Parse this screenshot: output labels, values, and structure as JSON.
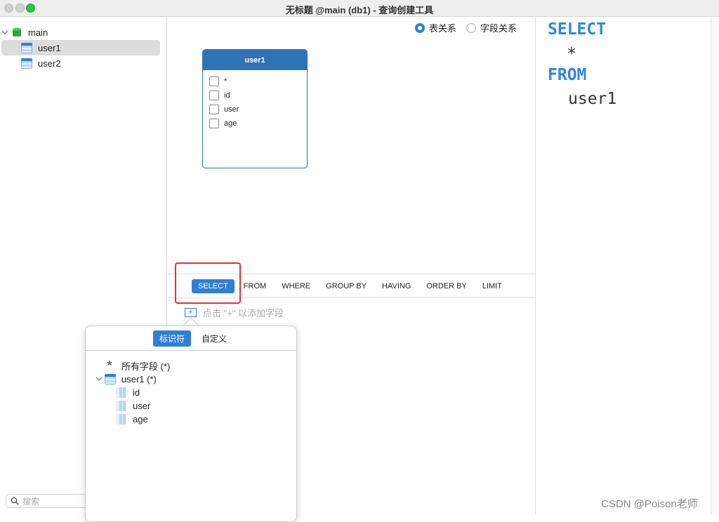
{
  "window": {
    "title": "无标题 @main (db1) - 查询创建工具"
  },
  "sidebar": {
    "database": "main",
    "tables": [
      "user1",
      "user2"
    ],
    "search_placeholder": "搜索"
  },
  "canvas": {
    "radio_table_relation": "表关系",
    "radio_field_relation": "字段关系",
    "table_card": {
      "name": "user1",
      "fields": [
        "*",
        "id",
        "user",
        "age"
      ]
    }
  },
  "clauses": [
    "SELECT",
    "FROM",
    "WHERE",
    "GROUP BY",
    "HAVING",
    "ORDER BY",
    "LIMIT"
  ],
  "add_field_hint": "点击 \"+\" 以添加字段",
  "popover": {
    "tab_identifier": "标识符",
    "tab_custom": "自定义",
    "all_fields": "所有字段 (*)",
    "table_node": "user1 (*)",
    "columns": [
      "id",
      "user",
      "age"
    ]
  },
  "sql": {
    "select_kw": "SELECT",
    "select_item": "*",
    "from_kw": "FROM",
    "from_item": "user1"
  },
  "watermark": "CSDN @Poison老师",
  "colors": {
    "accent": "#2f7fd6",
    "highlight": "#e0322f"
  }
}
